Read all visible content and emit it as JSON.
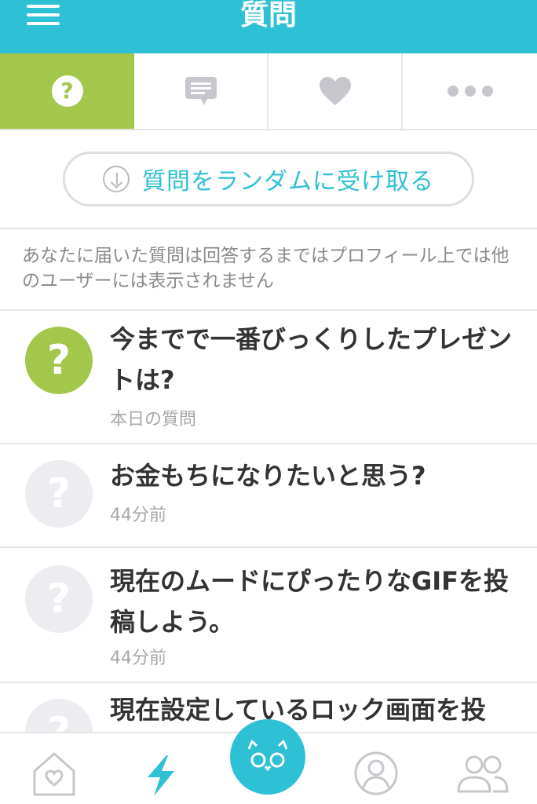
{
  "header": {
    "title": "質問",
    "menu_icon": "hamburger-icon",
    "color": "#2ec0d4"
  },
  "tabs": [
    {
      "icon": "question-icon",
      "active": true,
      "glyph": "?"
    },
    {
      "icon": "comment-icon",
      "active": false
    },
    {
      "icon": "heart-icon",
      "active": false
    },
    {
      "icon": "more-dots-icon",
      "active": false
    }
  ],
  "random_button": {
    "label": "質問をランダムに受け取る",
    "icon": "download-circle-icon"
  },
  "notice": "あなたに届いた質問は回答するまではプロフィール上では他のユーザーには表示されません",
  "questions": [
    {
      "avatar_glyph": "?",
      "text": "今までで一番びっくりしたプレゼントは?",
      "meta": "本日の質問",
      "highlight": true
    },
    {
      "avatar_glyph": "?",
      "text": "お金もちになりたいと思う?",
      "meta": "44分前",
      "highlight": false
    },
    {
      "avatar_glyph": "?",
      "text": "現在のムードにぴったりなGIFを投稿しよう。",
      "meta": "44分前",
      "highlight": false
    },
    {
      "avatar_glyph": "?",
      "text": "現在設定しているロック画面を投",
      "meta": "",
      "highlight": false
    }
  ],
  "bottom_nav": [
    {
      "icon": "home-heart-icon"
    },
    {
      "icon": "lightning-icon",
      "active": true
    },
    {
      "icon": "mascot-face-icon"
    },
    {
      "icon": "profile-icon"
    },
    {
      "icon": "friends-icon"
    }
  ],
  "colors": {
    "accent": "#2ec0d4",
    "green": "#a3c74a"
  }
}
